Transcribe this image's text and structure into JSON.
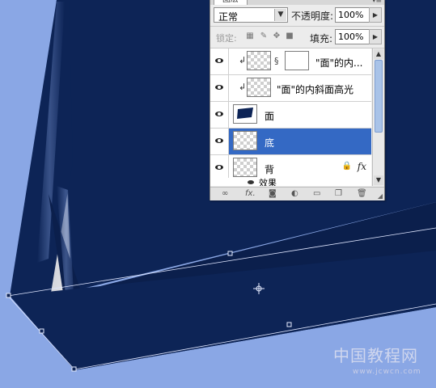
{
  "canvas": {
    "background_color": "#8aa7e5",
    "object_color": "#0d2456",
    "highlight_color": "#e9e9ec"
  },
  "panel": {
    "tab_title": "图层",
    "blend_mode": "正常",
    "opacity_label": "不透明度:",
    "opacity_value": "100%",
    "lock_label": "锁定:",
    "fill_label": "填充:",
    "fill_value": "100%",
    "layers": [
      {
        "name": "\"面\"的内...",
        "clipped": true,
        "has_mask": true,
        "selected": false
      },
      {
        "name": "\"面\"的内斜面高光",
        "clipped": true,
        "has_mask": false,
        "selected": false
      },
      {
        "name": "面",
        "clipped": false,
        "has_mask": false,
        "selected": false
      },
      {
        "name": "底",
        "clipped": false,
        "has_mask": false,
        "selected": true
      },
      {
        "name": "背",
        "clipped": false,
        "has_mask": false,
        "selected": false,
        "has_fx": true
      }
    ],
    "effect_label": "效果",
    "fx_label": "fx",
    "bottom_icons": [
      "link-icon",
      "fx-icon",
      "mask-icon",
      "adjustment-icon",
      "folder-icon",
      "new-layer-icon",
      "trash-icon"
    ]
  },
  "watermark": {
    "text": "中国教程网",
    "url": "www.jcwcn.com"
  }
}
